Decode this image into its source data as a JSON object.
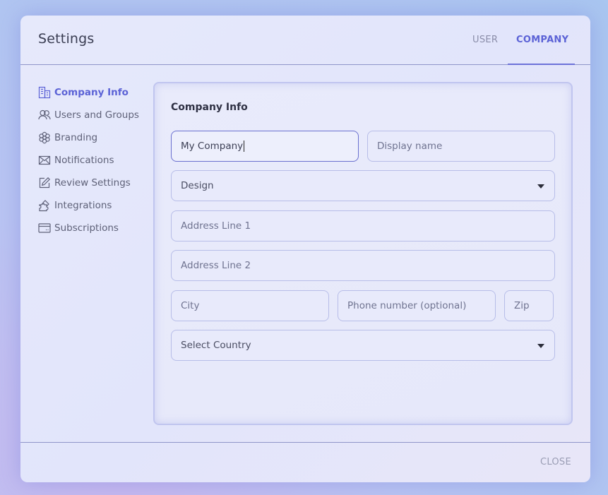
{
  "header": {
    "title": "Settings",
    "tabs": [
      {
        "label": "USER",
        "active": false
      },
      {
        "label": "COMPANY",
        "active": true
      }
    ]
  },
  "sidebar": {
    "items": [
      {
        "label": "Company Info",
        "icon": "building-icon",
        "active": true
      },
      {
        "label": "Users and Groups",
        "icon": "users-icon",
        "active": false
      },
      {
        "label": "Branding",
        "icon": "flower-icon",
        "active": false
      },
      {
        "label": "Notifications",
        "icon": "envelope-icon",
        "active": false
      },
      {
        "label": "Review Settings",
        "icon": "edit-icon",
        "active": false
      },
      {
        "label": "Integrations",
        "icon": "puzzle-icon",
        "active": false
      },
      {
        "label": "Subscriptions",
        "icon": "card-icon",
        "active": false
      }
    ]
  },
  "form": {
    "title": "Company Info",
    "company_name": {
      "value": "My Company"
    },
    "display_name": {
      "placeholder": "Display name"
    },
    "industry": {
      "value": "Design"
    },
    "address1": {
      "placeholder": "Address Line 1"
    },
    "address2": {
      "placeholder": "Address Line 2"
    },
    "city": {
      "placeholder": "City"
    },
    "phone": {
      "placeholder": "Phone number (optional)"
    },
    "zip": {
      "placeholder": "Zip"
    },
    "country": {
      "value": "Select Country"
    }
  },
  "footer": {
    "close_label": "CLOSE"
  },
  "colors": {
    "accent": "#5b62d6",
    "text": "#3a3d52",
    "muted": "#8a8da8",
    "border": "#b7bde8"
  }
}
